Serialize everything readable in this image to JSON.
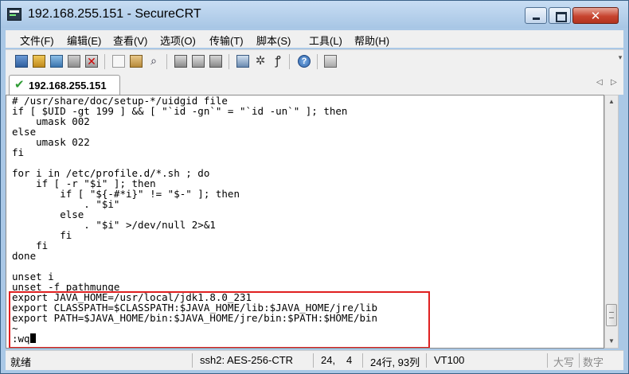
{
  "window": {
    "title": "192.168.255.151 - SecureCRT",
    "controls": {
      "minimize": "minimize",
      "maximize": "maximize",
      "close": "✕"
    }
  },
  "menu": {
    "items": [
      "文件(F)",
      "编辑(E)",
      "查看(V)",
      "选项(O)",
      "传输(T)",
      "脚本(S)",
      "工具(L)",
      "帮助(H)"
    ]
  },
  "toolbar": {
    "icons": [
      "connect-icon",
      "quick-connect-icon",
      "connect-in-tab-icon",
      "reconnect-icon",
      "disconnect-icon",
      "copy-icon",
      "paste-icon",
      "find-icon",
      "print-icon",
      "print-setup-icon",
      "print-selection-icon",
      "session-options-icon",
      "keymap-icon",
      "key-icon",
      "help-icon",
      "settings-icon"
    ]
  },
  "tabs": [
    {
      "label": "192.168.255.151",
      "status": "connected",
      "active": true
    }
  ],
  "terminal": {
    "lines": [
      "# /usr/share/doc/setup-*/uidgid file",
      "if [ $UID -gt 199 ] && [ \"`id -gn`\" = \"`id -un`\" ]; then",
      "    umask 002",
      "else",
      "    umask 022",
      "fi",
      "",
      "for i in /etc/profile.d/*.sh ; do",
      "    if [ -r \"$i\" ]; then",
      "        if [ \"${-#*i}\" != \"$-\" ]; then",
      "            . \"$i\"",
      "        else",
      "            . \"$i\" >/dev/null 2>&1",
      "        fi",
      "    fi",
      "done",
      "",
      "unset i",
      "unset -f pathmunge",
      "export JAVA_HOME=/usr/local/jdk1.8.0_231",
      "export CLASSPATH=$CLASSPATH:$JAVA_HOME/lib:$JAVA_HOME/jre/lib",
      "export PATH=$JAVA_HOME/bin:$JAVA_HOME/jre/bin:$PATH:$HOME/bin",
      "~",
      ":wq"
    ],
    "highlight_color": "#e02020"
  },
  "statusbar": {
    "ready": "就绪",
    "cipher": "ssh2: AES-256-CTR",
    "cursor_row": "24,",
    "cursor_col": "4",
    "size": "24行, 93列",
    "terminal_type": "VT100",
    "caps": "大写",
    "num": "数字"
  }
}
